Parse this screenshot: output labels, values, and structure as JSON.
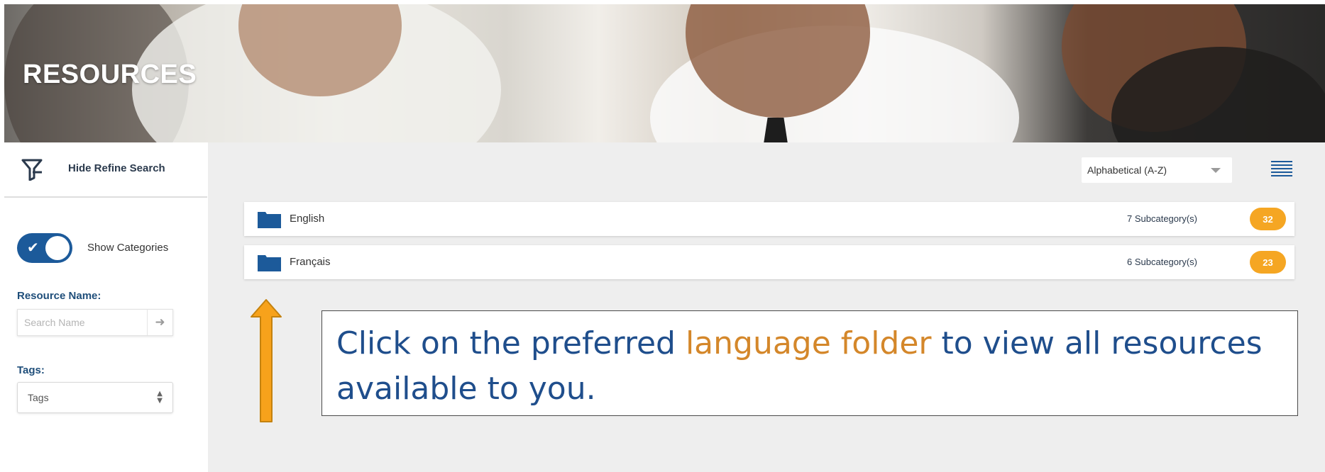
{
  "banner": {
    "title": "RESOURCES"
  },
  "sidebar": {
    "refine_label": "Hide Refine Search",
    "show_categories_label": "Show Categories",
    "show_categories_on": true,
    "resource_name_label": "Resource Name:",
    "search_placeholder": "Search Name",
    "tags_label": "Tags:",
    "tags_value": "Tags"
  },
  "toolbar": {
    "sort_value": "Alphabetical (A-Z)"
  },
  "folders": [
    {
      "name": "English",
      "subcategories": "7 Subcategory(s)",
      "count": "32"
    },
    {
      "name": "Français",
      "subcategories": "6 Subcategory(s)",
      "count": "23"
    }
  ],
  "callout": {
    "text_before": "Click on the preferred ",
    "highlight": "language folder",
    "text_after": " to view all resources available to you."
  },
  "colors": {
    "accent_blue": "#1c5a9a",
    "badge_orange": "#f5a623",
    "highlight_orange": "#d4872a",
    "callout_text": "#1f4e8c"
  }
}
